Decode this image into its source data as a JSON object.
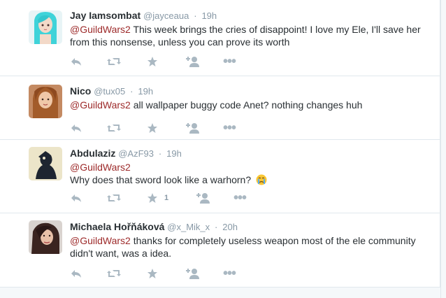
{
  "tweets": [
    {
      "fullname": "Jay Iamsombat",
      "username": "@jayceaua",
      "time": "19h",
      "mention": "@GuildWars2",
      "text": " This week brings the cries of disappoint! I love my Ele, I'll save her from this nonsense, unless you can prove its worth",
      "favorite_count": ""
    },
    {
      "fullname": "Nico",
      "username": "@tux05",
      "time": "19h",
      "mention": "@GuildWars2",
      "text": " all wallpaper buggy code Anet? nothing changes huh",
      "favorite_count": ""
    },
    {
      "fullname": "Abdulaziz",
      "username": "@AzF93",
      "time": "19h",
      "mention": "@GuildWars2",
      "text": "Why does that sword look like a warhorn?",
      "favorite_count": "1"
    },
    {
      "fullname": "Michaela Hořňáková",
      "username": "@x_Mik_x",
      "time": "20h",
      "mention": "@GuildWars2",
      "text": " thanks for completely useless weapon most of the ele community didn't want, was a idea.",
      "favorite_count": ""
    }
  ],
  "separator": "·",
  "more_label": "•••",
  "colors": {
    "mention": "#9d2a2a",
    "action_icon": "#aab8c2",
    "meta": "#8899a6"
  }
}
